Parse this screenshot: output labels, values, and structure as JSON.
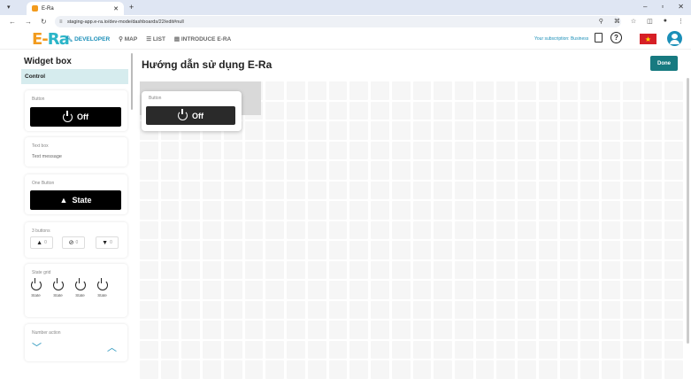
{
  "browser": {
    "tab_title": "E-Ra",
    "url": "staging-app.e-ra.io/dev-mode/dashboards/22/edit#null"
  },
  "header": {
    "logo_main": "E-",
    "logo_accent": "Ra",
    "menu": [
      {
        "label": "DEVELOPER",
        "icon": "wrench-icon",
        "active": true
      },
      {
        "label": "MAP",
        "icon": "map-pin-icon",
        "active": false
      },
      {
        "label": "LIST",
        "icon": "list-icon",
        "active": false
      },
      {
        "label": "INTRODUCE E-RA",
        "icon": "doc-icon",
        "active": false
      }
    ],
    "subscription": "Your subscription: Business",
    "help_symbol": "?",
    "flag_symbol": "★"
  },
  "sidebar": {
    "title": "Widget box",
    "category": "Control",
    "widgets": {
      "button": {
        "label": "Button",
        "value": "Off"
      },
      "text_box": {
        "label": "Text box",
        "value": "Text message"
      },
      "one_button": {
        "label": "One Button",
        "value": "State"
      },
      "three_buttons": {
        "label": "3 buttons",
        "hint": "0"
      },
      "state_grid": {
        "label": "State grid",
        "item_label": "State"
      },
      "number_action": {
        "label": "Number action"
      }
    }
  },
  "main": {
    "title": "Hướng dẫn sử dụng E-Ra",
    "done_label": "Done",
    "placed_widget": {
      "label": "Button",
      "value": "Off"
    }
  },
  "colors": {
    "accent": "#1b8fb8",
    "brand_orange": "#f29b1e",
    "done_bg": "#177a80"
  }
}
